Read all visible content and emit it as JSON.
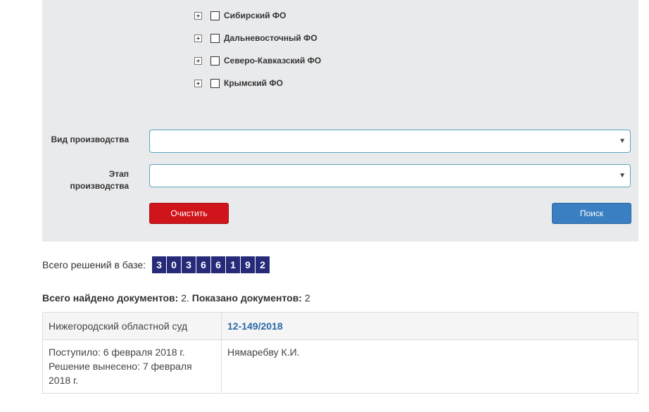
{
  "filters": {
    "districts": [
      {
        "label": "Сибирский ФО"
      },
      {
        "label": "Дальневосточный ФО"
      },
      {
        "label": "Северо-Кавказский ФО"
      },
      {
        "label": "Крымский ФО"
      }
    ],
    "proceeding_type": {
      "label": "Вид производства",
      "value": ""
    },
    "proceeding_stage": {
      "label_line1": "Этап",
      "label_line2": "производства",
      "value": ""
    },
    "clear_button": "Очистить",
    "search_button": "Поиск"
  },
  "stats": {
    "total_label": "Всего решений в базе:",
    "digits": [
      "3",
      "0",
      "3",
      "6",
      "6",
      "1",
      "9",
      "2"
    ],
    "found_label": "Всего найдено документов:",
    "found_value": " 2. ",
    "shown_label": "Показано документов:",
    "shown_value": " 2"
  },
  "results": [
    {
      "court": "Нижегородский областной суд",
      "case_number": "12-149/2018",
      "received": "Поступило: 6 февраля 2018 г.",
      "decision": "Решение вынесено: 7 февраля 2018 г.",
      "party": "Нямаребву К.И."
    }
  ],
  "colors": {
    "panel_bg": "#e9eaec",
    "clear_btn": "#d0141b",
    "search_btn": "#3a7fc1",
    "counter_bg": "#262a78",
    "link": "#2a6aa6"
  }
}
